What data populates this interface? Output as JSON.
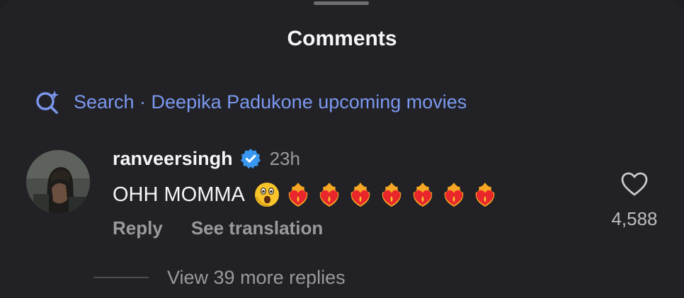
{
  "sheet": {
    "title": "Comments"
  },
  "search": {
    "label": "Search · Deepika Padukone upcoming movies"
  },
  "comment": {
    "username": "ranveersingh",
    "verified": true,
    "time": "23h",
    "text": "OHH MOMMA",
    "emojis": [
      "astonished-face-emoji",
      "heart-on-fire-emoji",
      "heart-on-fire-emoji",
      "heart-on-fire-emoji",
      "heart-on-fire-emoji",
      "heart-on-fire-emoji",
      "heart-on-fire-emoji",
      "heart-on-fire-emoji"
    ],
    "reply_label": "Reply",
    "translate_label": "See translation",
    "like_count": "4,588"
  },
  "replies": {
    "label": "View 39 more replies"
  },
  "colors": {
    "background": "#222226",
    "accent": "#7b98ef",
    "verified": "#3897f0",
    "secondary_text": "#9a9a9e"
  }
}
